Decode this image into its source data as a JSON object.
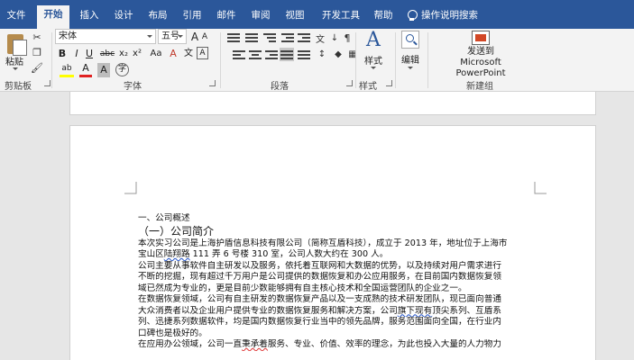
{
  "tabs": [
    {
      "label": "文件",
      "active": false
    },
    {
      "label": "开始",
      "active": true
    },
    {
      "label": "插入",
      "active": false
    },
    {
      "label": "设计",
      "active": false
    },
    {
      "label": "布局",
      "active": false
    },
    {
      "label": "引用",
      "active": false
    },
    {
      "label": "邮件",
      "active": false
    },
    {
      "label": "审阅",
      "active": false
    },
    {
      "label": "视图",
      "active": false
    },
    {
      "label": "开发工具",
      "active": false
    },
    {
      "label": "帮助",
      "active": false
    }
  ],
  "tell_me": "操作说明搜索",
  "ribbon": {
    "clipboard": {
      "paste_label": "粘贴",
      "group_label": "剪贴板"
    },
    "font": {
      "font_name": "宋体",
      "font_size": "五号",
      "group_label": "字体",
      "bold": "B",
      "italic": "I",
      "underline": "U",
      "strike": "abc",
      "sub": "x₂",
      "sup": "x²",
      "grow": "A",
      "shrink": "A",
      "aa": "Aa",
      "clear": "A",
      "phonetic": "文",
      "border_char": "A",
      "highlight": "ab",
      "font_color": "A",
      "shade": "A",
      "circle": "字"
    },
    "paragraph": {
      "group_label": "段落"
    },
    "styles": {
      "label": "样式",
      "group_label": "样式"
    },
    "editing": {
      "label": "编辑"
    },
    "new_group": {
      "line1": "发送到",
      "line2": "Microsoft PowerPoint",
      "group_label": "新建组"
    }
  },
  "document": {
    "heading1": "一、公司概述",
    "heading2": "（一）公司简介",
    "lines": [
      "本次实习公司是上海护盾信息科技有限公司（简称互盾科技），成立于 2013 年，地址位于上海市",
      "宝山区陆翔路 111 弄 6 号楼 310 室，公司人数大约在 300 人。",
      "公司主要从事软件自主研发以及服务，依托着互联网和大数据的优势，以及持续对用户需求进行",
      "不断的挖掘，现有超过千万用户是公司提供的数据恢复和办公应用服务，在目前国内数据恢复领",
      "域已然成为专业的，更是目前少数能够拥有自主核心技术和全国运营团队的企业之一。",
      "在数据恢复领域，公司有自主研发的数据恢复产品以及一支成熟的技术研发团队，现已面向普通",
      "大众消费者以及企业用户提供专业的数据恢复服务和解决方案，公司旗下现有顶尖系列、互盾系",
      "列、迅捷系列数据软件，均是国内数据恢复行业当中的领先品牌，服务范围面向全国，在行业内",
      "口碑也是极好的。",
      "在应用办公领域，公司一直秉承着服务、专业、价值、效率的理念，为此也投入大量的人力物力"
    ]
  }
}
